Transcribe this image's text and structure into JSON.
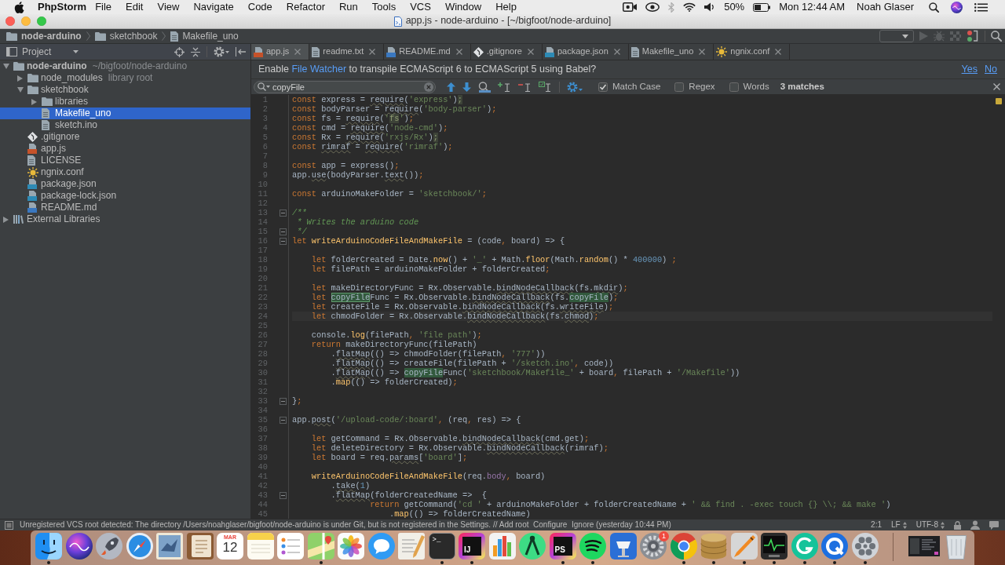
{
  "menu_bar": {
    "app_name": "PhpStorm",
    "menus": [
      "File",
      "Edit",
      "View",
      "Navigate",
      "Code",
      "Refactor",
      "Run",
      "Tools",
      "VCS",
      "Window",
      "Help"
    ],
    "battery": "50%",
    "clock": "Mon 12:44 AM",
    "user": "Noah Glaser"
  },
  "window": {
    "title": "app.js - node-arduino - [~/bigfoot/node-arduino]"
  },
  "breadcrumbs": [
    {
      "label": "node-arduino",
      "kind": "project"
    },
    {
      "label": "sketchbook",
      "kind": "folder"
    },
    {
      "label": "Makefile_uno",
      "kind": "text"
    }
  ],
  "project_panel": {
    "title": "Project",
    "tree": [
      {
        "label": "node-arduino",
        "hint": "~/bigfoot/node-arduino",
        "kind": "project",
        "expanded": true,
        "selected": false,
        "children": [
          {
            "label": "node_modules",
            "hint": "library root",
            "kind": "folder",
            "expanded": false,
            "selected": false
          },
          {
            "label": "sketchbook",
            "kind": "folder",
            "expanded": true,
            "selected": false,
            "children": [
              {
                "label": "libraries",
                "kind": "folder",
                "expanded": false,
                "selected": false
              },
              {
                "label": "Makefile_uno",
                "kind": "text",
                "selected": true
              },
              {
                "label": "sketch.ino",
                "kind": "text",
                "selected": false
              }
            ]
          },
          {
            "label": ".gitignore",
            "kind": "git",
            "selected": false
          },
          {
            "label": "app.js",
            "kind": "js",
            "selected": false
          },
          {
            "label": "LICENSE",
            "kind": "text",
            "selected": false
          },
          {
            "label": "ngnix.conf",
            "kind": "conf",
            "selected": false
          },
          {
            "label": "package.json",
            "kind": "json",
            "selected": false
          },
          {
            "label": "package-lock.json",
            "kind": "json",
            "selected": false
          },
          {
            "label": "README.md",
            "kind": "md",
            "selected": false
          }
        ]
      },
      {
        "label": "External Libraries",
        "kind": "libraries",
        "expanded": false,
        "selected": false
      }
    ]
  },
  "tabs": [
    {
      "label": "app.js",
      "kind": "js",
      "selected": true
    },
    {
      "label": "readme.txt",
      "kind": "text",
      "selected": false
    },
    {
      "label": "README.md",
      "kind": "md",
      "selected": false
    },
    {
      "label": ".gitignore",
      "kind": "git",
      "selected": false
    },
    {
      "label": "package.json",
      "kind": "json",
      "selected": false
    },
    {
      "label": "Makefile_uno",
      "kind": "text",
      "selected": false
    },
    {
      "label": "ngnix.conf",
      "kind": "conf",
      "selected": false
    }
  ],
  "banner": {
    "text_before": "Enable",
    "link": "File Watcher",
    "text_after": "to transpile ECMAScript 6 to ECMAScript 5 using Babel?",
    "actions": [
      "Yes",
      "No"
    ]
  },
  "find_bar": {
    "query": "copyFile",
    "options": [
      {
        "label": "Match Case",
        "checked": true
      },
      {
        "label": "Regex",
        "checked": false
      },
      {
        "label": "Words",
        "checked": false
      }
    ],
    "matches": "3 matches"
  },
  "editor": {
    "lines": [
      {
        "number": "1",
        "current": false,
        "fold": false,
        "tokens": [
          {
            "kind": "kw",
            "text": "const"
          },
          {
            "kind": "txt",
            "text": " express = "
          },
          {
            "kind": "warn",
            "text": "require"
          },
          {
            "kind": "txt",
            "text": "("
          },
          {
            "kind": "str",
            "text": "'express'"
          },
          {
            "kind": "txt",
            "text": ")"
          },
          {
            "kind": "mark",
            "text": ";"
          }
        ]
      },
      {
        "number": "2",
        "current": false,
        "fold": false,
        "tokens": [
          {
            "kind": "kw",
            "text": "const"
          },
          {
            "kind": "txt",
            "text": " bodyParser = "
          },
          {
            "kind": "warn",
            "text": "require"
          },
          {
            "kind": "txt",
            "text": "("
          },
          {
            "kind": "str",
            "text": "'body-parser'"
          },
          {
            "kind": "txt",
            "text": ")"
          },
          {
            "kind": "kw",
            "text": ";"
          }
        ]
      },
      {
        "number": "3",
        "current": false,
        "fold": false,
        "tokens": [
          {
            "kind": "kw",
            "text": "const"
          },
          {
            "kind": "txt",
            "text": " fs = "
          },
          {
            "kind": "warn",
            "text": "require"
          },
          {
            "kind": "txt",
            "text": "("
          },
          {
            "kind": "str",
            "text": "'"
          },
          {
            "kind": "mark",
            "text": "fs"
          },
          {
            "kind": "str",
            "text": "'"
          },
          {
            "kind": "txt",
            "text": ")"
          },
          {
            "kind": "kw",
            "text": ";"
          }
        ]
      },
      {
        "number": "4",
        "current": false,
        "fold": false,
        "tokens": [
          {
            "kind": "kw",
            "text": "const"
          },
          {
            "kind": "txt",
            "text": " cmd = "
          },
          {
            "kind": "warn",
            "text": "require"
          },
          {
            "kind": "txt",
            "text": "("
          },
          {
            "kind": "str",
            "text": "'node-cmd'"
          },
          {
            "kind": "txt",
            "text": ")"
          },
          {
            "kind": "kw",
            "text": ";"
          }
        ]
      },
      {
        "number": "5",
        "current": false,
        "fold": false,
        "tokens": [
          {
            "kind": "kw",
            "text": "const"
          },
          {
            "kind": "txt",
            "text": " Rx = "
          },
          {
            "kind": "warn",
            "text": "require"
          },
          {
            "kind": "txt",
            "text": "("
          },
          {
            "kind": "str",
            "text": "'rxjs/Rx'"
          },
          {
            "kind": "txt",
            "text": ")"
          },
          {
            "kind": "mark",
            "text": ";"
          }
        ]
      },
      {
        "number": "6",
        "current": false,
        "fold": false,
        "tokens": [
          {
            "kind": "kw",
            "text": "const "
          },
          {
            "kind": "warn",
            "text": "rimraf"
          },
          {
            "kind": "txt",
            "text": " = "
          },
          {
            "kind": "warn",
            "text": "require"
          },
          {
            "kind": "txt",
            "text": "("
          },
          {
            "kind": "str",
            "text": "'rimraf'"
          },
          {
            "kind": "txt",
            "text": ")"
          },
          {
            "kind": "kw",
            "text": ";"
          }
        ]
      },
      {
        "number": "7",
        "current": false,
        "fold": false
      },
      {
        "number": "8",
        "current": false,
        "fold": false,
        "tokens": [
          {
            "kind": "kw",
            "text": "const"
          },
          {
            "kind": "txt",
            "text": " app = express()"
          },
          {
            "kind": "kw",
            "text": ";"
          }
        ]
      },
      {
        "number": "9",
        "current": false,
        "fold": false,
        "tokens": [
          {
            "kind": "txt",
            "text": "app."
          },
          {
            "kind": "warn",
            "text": "use"
          },
          {
            "kind": "txt",
            "text": "(bodyParser."
          },
          {
            "kind": "warn",
            "text": "text"
          },
          {
            "kind": "txt",
            "text": "())"
          },
          {
            "kind": "kw",
            "text": ";"
          }
        ]
      },
      {
        "number": "10",
        "current": false,
        "fold": false
      },
      {
        "number": "11",
        "current": false,
        "fold": false,
        "tokens": [
          {
            "kind": "kw",
            "text": "const"
          },
          {
            "kind": "txt",
            "text": " arduinoMakeFolder = "
          },
          {
            "kind": "str",
            "text": "'sketchbook/'"
          },
          {
            "kind": "kw",
            "text": ";"
          }
        ]
      },
      {
        "number": "12",
        "current": false,
        "fold": false
      },
      {
        "number": "13",
        "current": false,
        "fold": true,
        "tokens": [
          {
            "kind": "doc",
            "text": "/**"
          }
        ]
      },
      {
        "number": "14",
        "current": false,
        "fold": false,
        "tokens": [
          {
            "kind": "doc",
            "text": " * Writes the arduino code"
          }
        ]
      },
      {
        "number": "15",
        "current": false,
        "fold": true,
        "tokens": [
          {
            "kind": "doc",
            "text": " */"
          }
        ]
      },
      {
        "number": "16",
        "current": false,
        "fold": true,
        "tokens": [
          {
            "kind": "kw",
            "text": "let "
          },
          {
            "kind": "fn",
            "text": "writeArduinoCodeFileAndMakeFile"
          },
          {
            "kind": "txt",
            "text": " = (code"
          },
          {
            "kind": "kw",
            "text": ","
          },
          {
            "kind": "txt",
            "text": " board) => {"
          }
        ]
      },
      {
        "number": "17",
        "current": false,
        "fold": false
      },
      {
        "number": "18",
        "current": false,
        "fold": false,
        "tokens": [
          {
            "kind": "kw",
            "text": "    let"
          },
          {
            "kind": "txt",
            "text": " folderCreated = Date."
          },
          {
            "kind": "fn",
            "text": "now"
          },
          {
            "kind": "txt",
            "text": "() + "
          },
          {
            "kind": "str",
            "text": "'_'"
          },
          {
            "kind": "txt",
            "text": " + Math."
          },
          {
            "kind": "fn",
            "text": "floor"
          },
          {
            "kind": "txt",
            "text": "(Math."
          },
          {
            "kind": "fn",
            "text": "random"
          },
          {
            "kind": "txt",
            "text": "() * "
          },
          {
            "kind": "num",
            "text": "400000"
          },
          {
            "kind": "txt",
            "text": ") "
          },
          {
            "kind": "kw",
            "text": ";"
          }
        ]
      },
      {
        "number": "19",
        "current": false,
        "fold": false,
        "tokens": [
          {
            "kind": "kw",
            "text": "    let"
          },
          {
            "kind": "txt",
            "text": " filePath = arduinoMakeFolder + folderCreated"
          },
          {
            "kind": "kw",
            "text": ";"
          }
        ]
      },
      {
        "number": "20",
        "current": false,
        "fold": false
      },
      {
        "number": "21",
        "current": false,
        "fold": false,
        "tokens": [
          {
            "kind": "kw",
            "text": "    let"
          },
          {
            "kind": "txt",
            "text": " makeDirectoryFunc = Rx.Observable."
          },
          {
            "kind": "warn",
            "text": "bindNodeCallback"
          },
          {
            "kind": "txt",
            "text": "(fs."
          },
          {
            "kind": "warn",
            "text": "mkdir"
          },
          {
            "kind": "txt",
            "text": ")"
          },
          {
            "kind": "kw",
            "text": ";"
          }
        ]
      },
      {
        "number": "22",
        "current": false,
        "fold": false,
        "tokens": [
          {
            "kind": "kw",
            "text": "    let "
          },
          {
            "kind": "hit_current",
            "text": "copyFile"
          },
          {
            "kind": "txt",
            "text": "Func = Rx.Observable."
          },
          {
            "kind": "warn",
            "text": "bindNodeCallback"
          },
          {
            "kind": "txt",
            "text": "(fs."
          },
          {
            "kind": "hit",
            "text": "copyFile"
          },
          {
            "kind": "txt",
            "text": ")"
          },
          {
            "kind": "kw",
            "text": ";"
          }
        ]
      },
      {
        "number": "23",
        "current": false,
        "fold": false,
        "tokens": [
          {
            "kind": "kw",
            "text": "    let"
          },
          {
            "kind": "txt",
            "text": " createFile = Rx.Observable."
          },
          {
            "kind": "warn",
            "text": "bindNodeCallback"
          },
          {
            "kind": "txt",
            "text": "(fs."
          },
          {
            "kind": "warn",
            "text": "writeFile"
          },
          {
            "kind": "txt",
            "text": ")"
          },
          {
            "kind": "kw",
            "text": ";"
          }
        ]
      },
      {
        "number": "24",
        "current": true,
        "fold": false,
        "tokens": [
          {
            "kind": "kw",
            "text": "    let"
          },
          {
            "kind": "txt",
            "text": " chmodFolder = Rx.Observable."
          },
          {
            "kind": "warn",
            "text": "bindNodeCallback"
          },
          {
            "kind": "txt",
            "text": "(fs."
          },
          {
            "kind": "warn",
            "text": "chmod"
          },
          {
            "kind": "txt",
            "text": ")"
          },
          {
            "kind": "kw",
            "text": ";"
          }
        ]
      },
      {
        "number": "25",
        "current": false,
        "fold": false
      },
      {
        "number": "26",
        "current": false,
        "fold": false,
        "tokens": [
          {
            "kind": "txt",
            "text": "    console."
          },
          {
            "kind": "fn",
            "text": "log"
          },
          {
            "kind": "txt",
            "text": "(filePath"
          },
          {
            "kind": "kw",
            "text": ", "
          },
          {
            "kind": "str",
            "text": "'file path'"
          },
          {
            "kind": "txt",
            "text": ")"
          },
          {
            "kind": "kw",
            "text": ";"
          }
        ]
      },
      {
        "number": "27",
        "current": false,
        "fold": false,
        "tokens": [
          {
            "kind": "kw",
            "text": "    return"
          },
          {
            "kind": "txt",
            "text": " makeDirectoryFunc(filePath)"
          }
        ]
      },
      {
        "number": "28",
        "current": false,
        "fold": false,
        "tokens": [
          {
            "kind": "txt",
            "text": "        ."
          },
          {
            "kind": "warn",
            "text": "flatMap"
          },
          {
            "kind": "txt",
            "text": "(() => chmodFolder(filePath"
          },
          {
            "kind": "kw",
            "text": ", "
          },
          {
            "kind": "str",
            "text": "'777'"
          },
          {
            "kind": "txt",
            "text": "))"
          }
        ]
      },
      {
        "number": "29",
        "current": false,
        "fold": false,
        "tokens": [
          {
            "kind": "txt",
            "text": "        ."
          },
          {
            "kind": "warn",
            "text": "flatMap"
          },
          {
            "kind": "txt",
            "text": "(() => createFile(filePath + "
          },
          {
            "kind": "str",
            "text": "'/sketch.ino'"
          },
          {
            "kind": "kw",
            "text": ","
          },
          {
            "kind": "txt",
            "text": " code))"
          }
        ]
      },
      {
        "number": "30",
        "current": false,
        "fold": false,
        "tokens": [
          {
            "kind": "txt",
            "text": "        ."
          },
          {
            "kind": "warn",
            "text": "flatMap"
          },
          {
            "kind": "txt",
            "text": "(() => "
          },
          {
            "kind": "hit",
            "text": "copyFile"
          },
          {
            "kind": "txt",
            "text": "Func("
          },
          {
            "kind": "str",
            "text": "'sketchbook/Makefile_'"
          },
          {
            "kind": "txt",
            "text": " + board"
          },
          {
            "kind": "kw",
            "text": ","
          },
          {
            "kind": "txt",
            "text": " filePath + "
          },
          {
            "kind": "str",
            "text": "'/Makefile'"
          },
          {
            "kind": "txt",
            "text": "))"
          }
        ]
      },
      {
        "number": "31",
        "current": false,
        "fold": false,
        "tokens": [
          {
            "kind": "txt",
            "text": "        ."
          },
          {
            "kind": "fn",
            "text": "map"
          },
          {
            "kind": "txt",
            "text": "(() => folderCreated)"
          },
          {
            "kind": "kw",
            "text": ";"
          }
        ]
      },
      {
        "number": "32",
        "current": false,
        "fold": false
      },
      {
        "number": "33",
        "current": false,
        "fold": true,
        "tokens": [
          {
            "kind": "txt",
            "text": "}"
          },
          {
            "kind": "kw",
            "text": ";"
          }
        ]
      },
      {
        "number": "34",
        "current": false,
        "fold": false
      },
      {
        "number": "35",
        "current": false,
        "fold": true,
        "tokens": [
          {
            "kind": "txt",
            "text": "app."
          },
          {
            "kind": "warn",
            "text": "post"
          },
          {
            "kind": "txt",
            "text": "("
          },
          {
            "kind": "str",
            "text": "'/upload-code/:board'"
          },
          {
            "kind": "kw",
            "text": ","
          },
          {
            "kind": "txt",
            "text": " (req"
          },
          {
            "kind": "kw",
            "text": ","
          },
          {
            "kind": "txt",
            "text": " res) => {"
          }
        ]
      },
      {
        "number": "36",
        "current": false,
        "fold": false
      },
      {
        "number": "37",
        "current": false,
        "fold": false,
        "tokens": [
          {
            "kind": "kw",
            "text": "    let"
          },
          {
            "kind": "txt",
            "text": " getCommand = Rx.Observable."
          },
          {
            "kind": "warn",
            "text": "bindNodeCallback"
          },
          {
            "kind": "txt",
            "text": "(cmd.get)"
          },
          {
            "kind": "kw",
            "text": ";"
          }
        ]
      },
      {
        "number": "38",
        "current": false,
        "fold": false,
        "tokens": [
          {
            "kind": "kw",
            "text": "    let"
          },
          {
            "kind": "txt",
            "text": " deleteDirectory = Rx.Observable."
          },
          {
            "kind": "warn",
            "text": "bindNodeCallback"
          },
          {
            "kind": "txt",
            "text": "(rimraf)"
          },
          {
            "kind": "kw",
            "text": ";"
          }
        ]
      },
      {
        "number": "39",
        "current": false,
        "fold": false,
        "tokens": [
          {
            "kind": "kw",
            "text": "    let"
          },
          {
            "kind": "txt",
            "text": " board = req."
          },
          {
            "kind": "warn",
            "text": "params"
          },
          {
            "kind": "txt",
            "text": "["
          },
          {
            "kind": "str",
            "text": "'board'"
          },
          {
            "kind": "txt",
            "text": "]"
          },
          {
            "kind": "kw",
            "text": ";"
          }
        ]
      },
      {
        "number": "40",
        "current": false,
        "fold": false
      },
      {
        "number": "41",
        "current": false,
        "fold": false,
        "tokens": [
          {
            "kind": "fn",
            "text": "    writeArduinoCodeFileAndMakeFile"
          },
          {
            "kind": "txt",
            "text": "(req."
          },
          {
            "kind": "prop",
            "text": "body"
          },
          {
            "kind": "kw",
            "text": ","
          },
          {
            "kind": "txt",
            "text": " board)"
          }
        ]
      },
      {
        "number": "42",
        "current": false,
        "fold": false,
        "tokens": [
          {
            "kind": "txt",
            "text": "        ."
          },
          {
            "kind": "warn",
            "text": "take"
          },
          {
            "kind": "txt",
            "text": "("
          },
          {
            "kind": "num",
            "text": "1"
          },
          {
            "kind": "txt",
            "text": ")"
          }
        ]
      },
      {
        "number": "43",
        "current": false,
        "fold": true,
        "tokens": [
          {
            "kind": "txt",
            "text": "        ."
          },
          {
            "kind": "warn",
            "text": "flatMap"
          },
          {
            "kind": "txt",
            "text": "(folderCreatedName =>  {"
          }
        ]
      },
      {
        "number": "44",
        "current": false,
        "fold": false,
        "tokens": [
          {
            "kind": "kw",
            "text": "                return"
          },
          {
            "kind": "txt",
            "text": " getCommand("
          },
          {
            "kind": "str",
            "text": "'cd '"
          },
          {
            "kind": "txt",
            "text": " + arduinoMakeFolder + folderCreatedName + "
          },
          {
            "kind": "str",
            "text": "' && find . -exec touch {} \\\\; && make '"
          },
          {
            "kind": "txt",
            "text": ")"
          }
        ]
      },
      {
        "number": "45",
        "current": false,
        "fold": false,
        "tokens": [
          {
            "kind": "txt",
            "text": "                    ."
          },
          {
            "kind": "fn",
            "text": "map"
          },
          {
            "kind": "txt",
            "text": "(() => folderCreatedName)"
          }
        ]
      }
    ]
  },
  "status_bar": {
    "message": "Unregistered VCS root detected: The directory /Users/noahglaser/bigfoot/node-arduino is under Git, but is not registered in the Settings. // Add root  Configure  Ignore (yesterday 10:44 PM)",
    "position": "2:1",
    "line_separator": "LF",
    "encoding": "UTF-8"
  },
  "dock": [
    {
      "kind": "face",
      "running": true
    },
    {
      "kind": "orb",
      "running": false
    },
    {
      "kind": "rocket",
      "running": false
    },
    {
      "kind": "compass",
      "running": false
    },
    {
      "kind": "stamp",
      "running": false
    },
    {
      "kind": "book",
      "running": false
    },
    {
      "kind": "calendar",
      "month": "MAR",
      "day": "12",
      "running": false
    },
    {
      "kind": "notes",
      "running": false
    },
    {
      "kind": "checklist",
      "running": false
    },
    {
      "kind": "map",
      "running": true
    },
    {
      "kind": "pinwheel",
      "running": false
    },
    {
      "kind": "bubble",
      "running": false
    },
    {
      "kind": "document",
      "running": false
    },
    {
      "kind": "terminal",
      "label": ">_",
      "running": true
    },
    {
      "kind": "tile",
      "label": "IJ",
      "running": true
    },
    {
      "kind": "bars",
      "running": false
    },
    {
      "kind": "drafting",
      "running": false
    },
    {
      "kind": "tile",
      "label": "PS",
      "running": true
    },
    {
      "kind": "waves",
      "running": true
    },
    {
      "kind": "lectern",
      "running": false
    },
    {
      "kind": "gear",
      "badge": "1",
      "running": false
    },
    {
      "kind": "ring",
      "running": true
    },
    {
      "kind": "database",
      "running": true
    },
    {
      "kind": "pen",
      "running": true
    },
    {
      "kind": "monitor",
      "running": true
    },
    {
      "kind": "swirl",
      "running": true
    },
    {
      "kind": "ringlogo",
      "running": true
    },
    {
      "kind": "reel",
      "running": true
    },
    {
      "kind": "divider"
    },
    {
      "kind": "thumbnail"
    },
    {
      "kind": "trash"
    }
  ]
}
